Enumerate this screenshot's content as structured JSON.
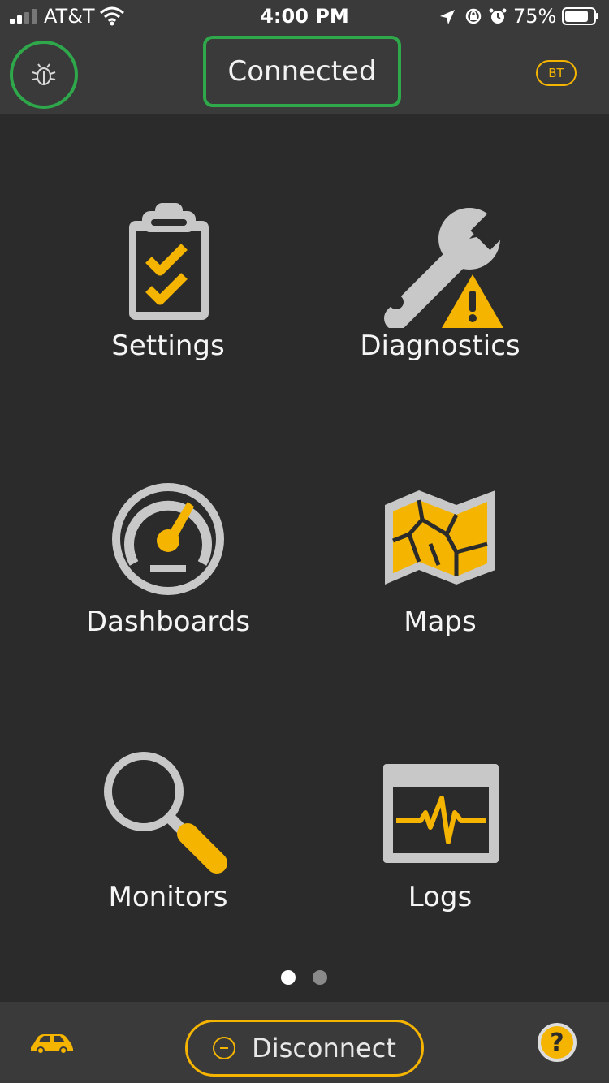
{
  "status_bar": {
    "carrier": "AT&T",
    "time": "4:00 PM",
    "battery": "75%"
  },
  "nav": {
    "title": "Connected",
    "bt_badge": "BT"
  },
  "tiles": [
    {
      "label": "Settings",
      "icon": "clipboard-check-icon"
    },
    {
      "label": "Diagnostics",
      "icon": "wrench-warning-icon"
    },
    {
      "label": "Dashboards",
      "icon": "gauge-icon"
    },
    {
      "label": "Maps",
      "icon": "map-icon"
    },
    {
      "label": "Monitors",
      "icon": "magnifier-icon"
    },
    {
      "label": "Logs",
      "icon": "waveform-icon"
    }
  ],
  "pager": {
    "total": 2,
    "current": 1
  },
  "bottom_bar": {
    "disconnect_label": "Disconnect",
    "help_label": "?"
  },
  "colors": {
    "accent": "#f4b400",
    "connected": "#2ea84a",
    "icon_gray": "#c8c8c8",
    "background": "#2b2b2b",
    "bar": "#3a3a3a"
  }
}
